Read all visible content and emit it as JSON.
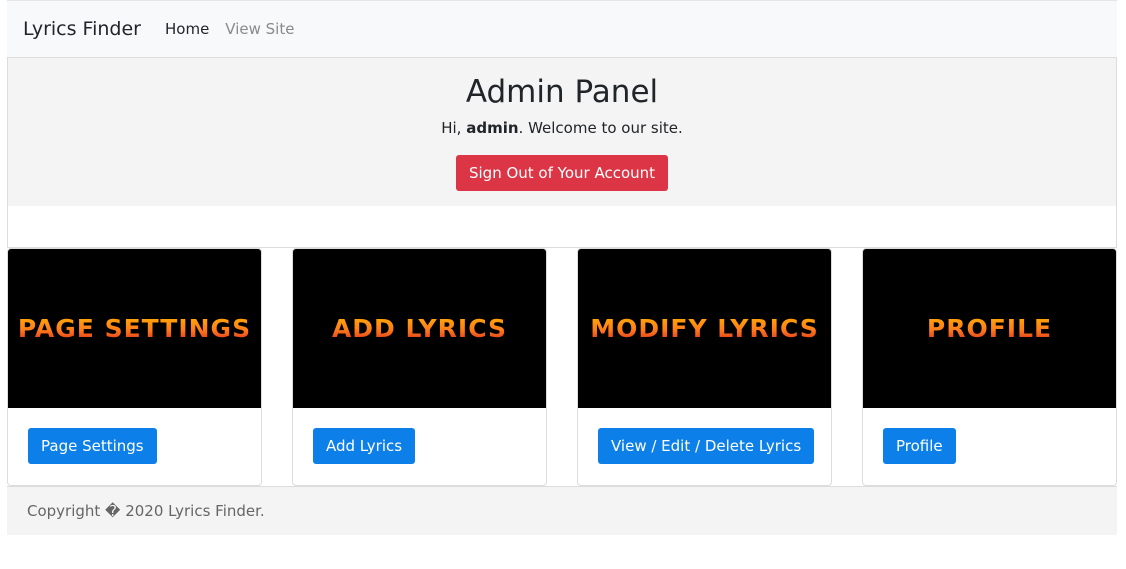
{
  "navbar": {
    "brand": "Lyrics Finder",
    "links": [
      "Home",
      "View Site"
    ]
  },
  "header": {
    "title": "Admin Panel",
    "greeting_prefix": "Hi, ",
    "username": "admin",
    "greeting_suffix": ". Welcome to our site.",
    "signout_label": "Sign Out of Your Account"
  },
  "cards": [
    {
      "image_text": "PAGE SETTINGS",
      "button": "Page Settings"
    },
    {
      "image_text": "ADD LYRICS",
      "button": "Add Lyrics"
    },
    {
      "image_text": "MODIFY LYRICS",
      "button": "View / Edit / Delete Lyrics"
    },
    {
      "image_text": "PROFILE",
      "button": "Profile"
    }
  ],
  "footer": {
    "copyright": "Copyright � 2020 Lyrics Finder."
  },
  "colors": {
    "primary": "#0d7fe8",
    "danger": "#dc3545",
    "card_image_bg": "#000000"
  }
}
